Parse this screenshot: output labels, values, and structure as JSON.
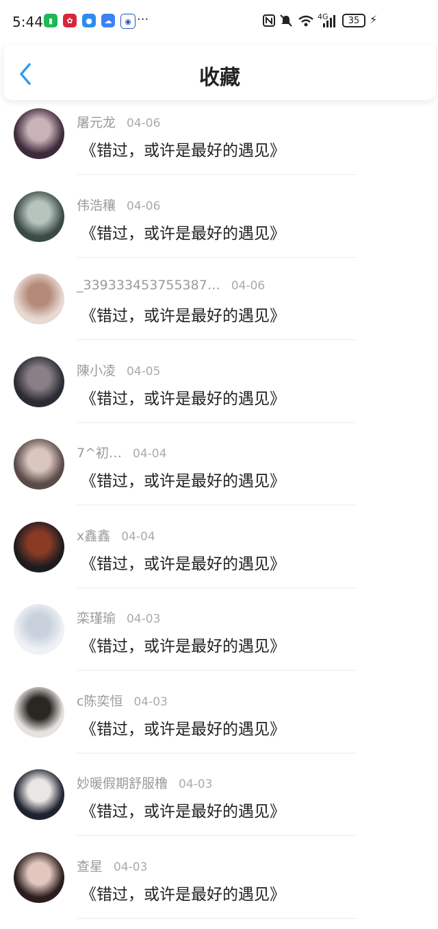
{
  "status_bar": {
    "time": "5:44",
    "more": "···",
    "network_label": "4G",
    "battery": "35",
    "app_icons": [
      "green-app-icon",
      "huawei-app-icon",
      "message-app-icon",
      "cloud-app-icon",
      "bank-app-icon"
    ]
  },
  "header": {
    "title": "收藏"
  },
  "items": [
    {
      "name": "屠元龙",
      "date": "04-06",
      "text": "《错过，或许是最好的遇见》",
      "avatar_colors": [
        "#3d2a3a",
        "#c9b3b8"
      ]
    },
    {
      "name": "伟浩穰",
      "date": "04-06",
      "text": "《错过，或许是最好的遇见》",
      "avatar_colors": [
        "#3a4a44",
        "#b7c3bd"
      ]
    },
    {
      "name": "_339333453755387…",
      "date": "04-06",
      "text": "《错过，或许是最好的遇见》",
      "avatar_colors": [
        "#e8d9d2",
        "#b58a7a"
      ]
    },
    {
      "name": "陳小凌",
      "date": "04-05",
      "text": "《错过，或许是最好的遇见》",
      "avatar_colors": [
        "#2b2b35",
        "#8a7f86"
      ]
    },
    {
      "name": "7^初…",
      "date": "04-04",
      "text": "《错过，或许是最好的遇见》",
      "avatar_colors": [
        "#5a4a48",
        "#d9c6bf"
      ]
    },
    {
      "name": "x鑫鑫",
      "date": "04-04",
      "text": "《错过，或许是最好的遇见》",
      "avatar_colors": [
        "#1c1c1f",
        "#8b3b24"
      ]
    },
    {
      "name": "栾瑾瑜",
      "date": "04-03",
      "text": "《错过，或许是最好的遇见》",
      "avatar_colors": [
        "#eef1f5",
        "#c9d1dc"
      ]
    },
    {
      "name": "c陈奕恒",
      "date": "04-03",
      "text": "《错过，或许是最好的遇见》",
      "avatar_colors": [
        "#e6e2df",
        "#2a2622"
      ]
    },
    {
      "name": "妙暖假期舒服橹",
      "date": "04-03",
      "text": "《错过，或许是最好的遇见》",
      "avatar_colors": [
        "#1f2230",
        "#e9e6e4"
      ]
    },
    {
      "name": "查星",
      "date": "04-03",
      "text": "《错过，或许是最好的遇见》",
      "avatar_colors": [
        "#2a1d1d",
        "#e3c7bf"
      ]
    }
  ]
}
